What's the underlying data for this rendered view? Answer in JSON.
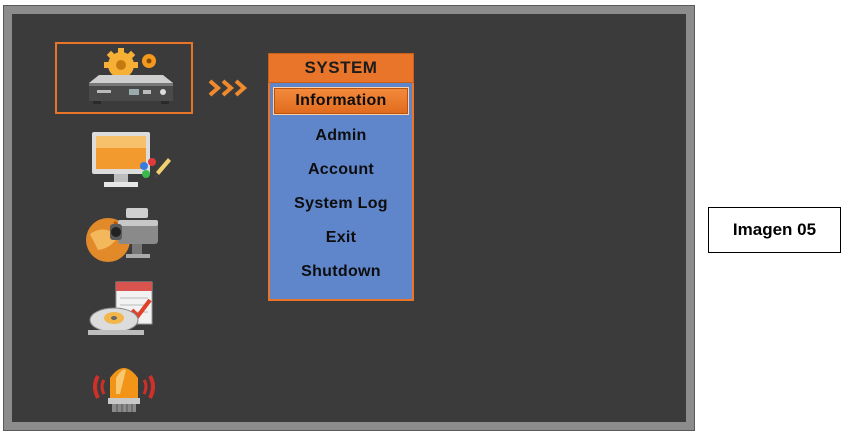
{
  "menu": {
    "title": "SYSTEM",
    "items": [
      {
        "label": "Information",
        "selected": true
      },
      {
        "label": "Admin",
        "selected": false
      },
      {
        "label": "Account",
        "selected": false
      },
      {
        "label": "System Log",
        "selected": false
      },
      {
        "label": "Exit",
        "selected": false
      },
      {
        "label": "Shutdown",
        "selected": false
      }
    ]
  },
  "categories": [
    {
      "name": "system",
      "icon": "dvr-settings-icon",
      "selected": true
    },
    {
      "name": "display",
      "icon": "monitor-paint-icon",
      "selected": false
    },
    {
      "name": "record",
      "icon": "camera-globe-icon",
      "selected": false
    },
    {
      "name": "schedule",
      "icon": "calendar-disc-icon",
      "selected": false
    },
    {
      "name": "alarm",
      "icon": "alarm-siren-icon",
      "selected": false
    }
  ],
  "caption": "Imagen 05",
  "colors": {
    "accent": "#e8752a",
    "menu_body": "#5f85cb",
    "screen_bg": "#3b3b3b",
    "frame": "#8c8c8c"
  }
}
